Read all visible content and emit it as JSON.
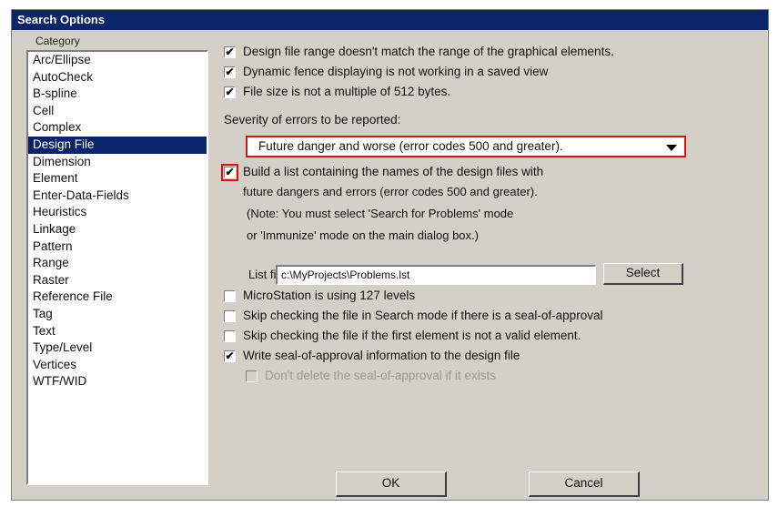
{
  "window": {
    "title": "Search Options"
  },
  "category": {
    "label": "Category",
    "items": [
      "Arc/Ellipse",
      "AutoCheck",
      "B-spline",
      "Cell",
      "Complex",
      "Design File",
      "Dimension",
      "Element",
      "Enter-Data-Fields",
      "Heuristics",
      "Linkage",
      "Pattern",
      "Range",
      "Raster",
      "Reference File",
      "Tag",
      "Text",
      "Type/Level",
      "Vertices",
      "WTF/WID"
    ],
    "selected": "Design File"
  },
  "options": {
    "range_mismatch": {
      "label": "Design file range doesn't match the range of the graphical elements.",
      "checked": true
    },
    "dynamic_fence": {
      "label": "Dynamic fence displaying is not working in a saved view",
      "checked": true
    },
    "file_size": {
      "label": "File size is not a multiple of 512 bytes.",
      "checked": true
    },
    "severity_label": "Severity of errors to be reported:",
    "severity_value": "Future danger and worse (error codes 500 and greater).",
    "build_list": {
      "label_line1": "Build a list containing the names of the design files with",
      "label_line2": "future dangers and errors (error codes 500 and greater).",
      "checked": true
    },
    "note_line1": "(Note: You must select 'Search for Problems' mode",
    "note_line2": "or 'Immunize' mode on the main dialog box.)",
    "list_file_label": "List file:",
    "list_file_value": "c:\\MyProjects\\Problems.lst",
    "select_button": "Select",
    "microstation_127": {
      "label": "MicroStation is using 127 levels",
      "checked": false
    },
    "skip_seal": {
      "label": "Skip checking the file in Search mode if there is a seal-of-approval",
      "checked": false
    },
    "skip_first_invalid": {
      "label": "Skip checking the file if the first element is not a valid element.",
      "checked": false
    },
    "write_seal": {
      "label": "Write seal-of-approval information to the design file",
      "checked": true
    },
    "dont_delete_seal": {
      "label": "Don't delete the seal-of-approval if it exists",
      "checked": false,
      "disabled": true
    }
  },
  "buttons": {
    "ok": "OK",
    "cancel": "Cancel"
  },
  "colors": {
    "title_bar": "#0a246a",
    "highlight_frame": "#dd1111",
    "dialog_face": "#d4d0c8"
  }
}
